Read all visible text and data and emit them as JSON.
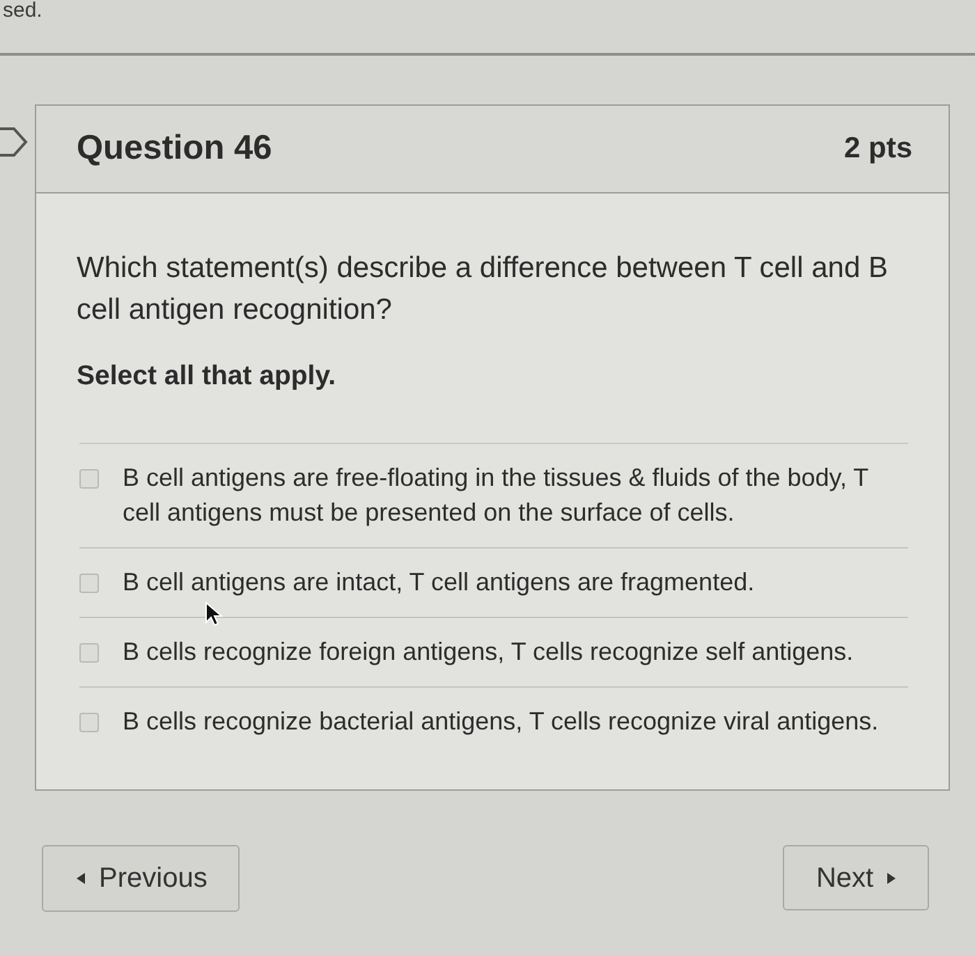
{
  "page_top_text": "sed.",
  "question": {
    "title": "Question 46",
    "points": "2 pts",
    "prompt": "Which statement(s) describe a difference between T cell and B cell antigen recognition?",
    "instruction": "Select all that apply.",
    "answers": [
      {
        "text": "B cell antigens are free-floating in the tissues & fluids of the body, T cell antigens must be presented on the surface of cells.",
        "checked": false
      },
      {
        "text": "B cell antigens are intact, T cell antigens are fragmented.",
        "checked": false
      },
      {
        "text": "B cells recognize foreign antigens, T cells recognize self antigens.",
        "checked": false
      },
      {
        "text": "B cells recognize bacterial antigens, T cells recognize viral antigens.",
        "checked": false
      }
    ]
  },
  "navigation": {
    "previous": "Previous",
    "next": "Next"
  }
}
